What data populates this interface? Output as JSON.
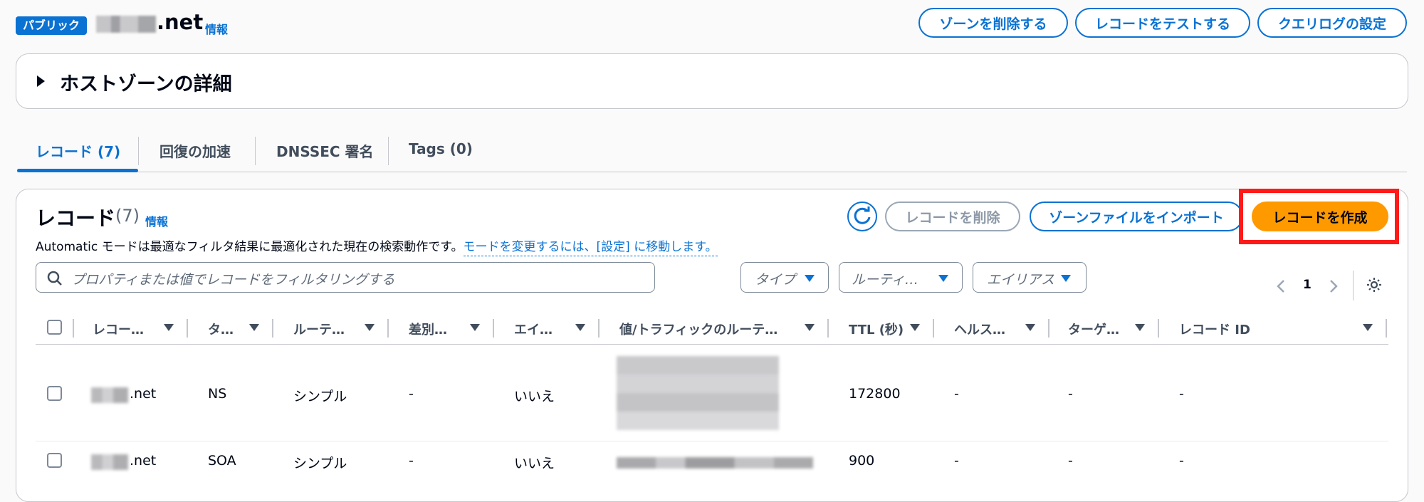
{
  "header": {
    "badge": "パブリック",
    "zone_suffix": ".net",
    "info": "情報",
    "actions": [
      "ゾーンを削除する",
      "レコードをテストする",
      "クエリログの設定"
    ]
  },
  "details": {
    "title": "ホストゾーンの詳細"
  },
  "tabs": [
    "レコード (7)",
    "回復の加速",
    "DNSSEC 署名",
    "Tags (0)"
  ],
  "records": {
    "title": "レコード",
    "count": "(7)",
    "info": "情報",
    "buttons": {
      "delete": "レコードを削除",
      "import": "ゾーンファイルをインポート",
      "create": "レコードを作成"
    },
    "description": "Automatic モードは最適なフィルタ結果に最適化された現在の検索動作です。",
    "description_link": "モードを変更するには、[設定] に移動します。",
    "search_placeholder": "プロパティまたは値でレコードをフィルタリングする",
    "filters": [
      "タイプ",
      "ルーティ…",
      "エイリアス"
    ],
    "page": "1",
    "columns": [
      "レコー…",
      "タ…",
      "ルーテ…",
      "差別…",
      "エイ…",
      "値/トラフィックのルーテ…",
      "TTL (秒)",
      "ヘルス…",
      "ターゲ…",
      "レコード ID"
    ],
    "rows": [
      {
        "name": ".net",
        "type": "NS",
        "routing": "シンプル",
        "diff": "-",
        "alias": "いいえ",
        "ttl": "172800",
        "health": "-",
        "target": "-",
        "id": "-"
      },
      {
        "name": ".net",
        "type": "SOA",
        "routing": "シンプル",
        "diff": "-",
        "alias": "いいえ",
        "ttl": "900",
        "health": "-",
        "target": "-",
        "id": "-"
      }
    ]
  },
  "colors": {
    "accent": "#0972d3",
    "primary": "#ff9900",
    "highlight": "#ff1a1a"
  }
}
